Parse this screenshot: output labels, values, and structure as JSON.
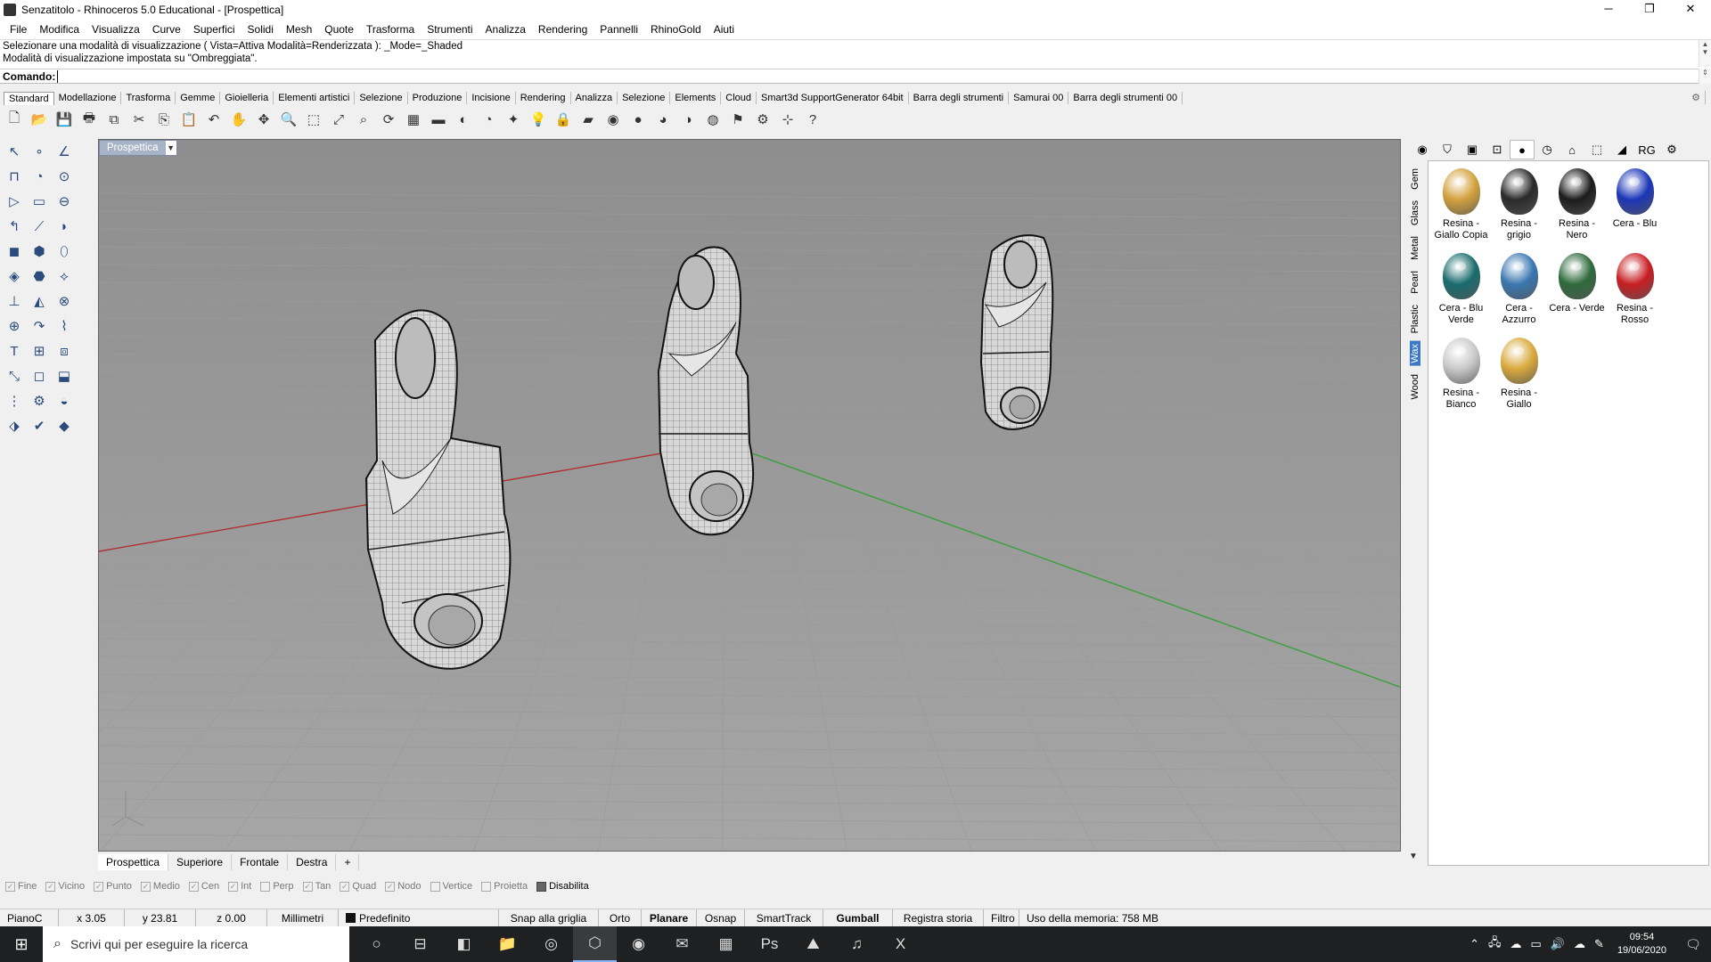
{
  "window": {
    "title": "Senzatitolo - Rhinoceros 5.0 Educational - [Prospettica]",
    "controls": [
      "─",
      "❐",
      "✕"
    ]
  },
  "menu": [
    "File",
    "Modifica",
    "Visualizza",
    "Curve",
    "Superfici",
    "Solidi",
    "Mesh",
    "Quote",
    "Trasforma",
    "Strumenti",
    "Analizza",
    "Rendering",
    "Pannelli",
    "RhinoGold",
    "Aiuti"
  ],
  "command": {
    "history": [
      "Selezionare una modalità di visualizzazione ( Vista=Attiva  Modalità=Renderizzata ): _Mode=_Shaded",
      "Modalità di visualizzazione impostata su \"Ombreggiata\"."
    ],
    "prompt": "Comando:"
  },
  "toolbar_tabs": [
    "Standard",
    "Modellazione",
    "Trasforma",
    "Gemme",
    "Gioielleria",
    "Elementi artistici",
    "Selezione",
    "Produzione",
    "Incisione",
    "Rendering",
    "Analizza",
    "Selezione",
    "Elements",
    "Cloud",
    "Smart3d SupportGenerator 64bit",
    "Barra degli strumenti",
    "Samurai 00",
    "Barra degli strumenti 00"
  ],
  "toolbar_icons": [
    "new-icon",
    "open-icon",
    "save-icon",
    "print-icon",
    "copy-page-icon",
    "cut-icon",
    "copy-icon",
    "paste-icon",
    "undo-icon",
    "pan-icon",
    "move-icon",
    "zoom-icon",
    "zoom-window-icon",
    "zoom-extents-icon",
    "zoom-selected-icon",
    "rotate-view-icon",
    "grid-icon",
    "car-icon",
    "render-preview-icon",
    "camera-icon",
    "grab-icon",
    "light-icon",
    "lock-icon",
    "layer-icon",
    "color-wheel-icon",
    "sphere-icon",
    "shaded-sphere-icon",
    "rendered-sphere-icon",
    "blue-sphere-icon",
    "flag-icon",
    "gear-icon",
    "snap-icon",
    "help-icon"
  ],
  "toolbar_glyphs": [
    "🗋",
    "📂",
    "💾",
    "🖶",
    "⧉",
    "✂",
    "⎘",
    "📋",
    "↶",
    "✋",
    "✥",
    "🔍",
    "⬚",
    "⤢",
    "⌕",
    "⟳",
    "▦",
    "▬",
    "◐",
    "◔",
    "✦",
    "💡",
    "🔒",
    "▰",
    "◉",
    "●",
    "◕",
    "◑",
    "◍",
    "⚑",
    "⚙",
    "⊹",
    "?"
  ],
  "left_tools": [
    "↖",
    "∘",
    "∠",
    "⊓",
    "◔",
    "⊙",
    "▷",
    "▭",
    "⊖",
    "↰",
    "⟋",
    "◗",
    "◼",
    "⬢",
    "⬯",
    "◈",
    "⬣",
    "⟡",
    "⊥",
    "◭",
    "⊗",
    "⊕",
    "↷",
    "⌇",
    "T",
    "⊞",
    "⧈",
    "⤡",
    "◻",
    "⬓",
    "⋮",
    "⚙",
    "◒",
    "⬗",
    "✔",
    "◆"
  ],
  "viewport": {
    "label": "Prospettica"
  },
  "viewport_tabs": [
    "Prospettica",
    "Superiore",
    "Frontale",
    "Destra",
    "+"
  ],
  "panel": {
    "top_icons": [
      "◉",
      "⛉",
      "▣",
      "⊡",
      "●",
      "◷",
      "⌂",
      "⬚",
      "◢",
      "RG",
      "⚙"
    ],
    "categories": [
      "Gem",
      "Glass",
      "Metal",
      "Pearl",
      "Plastic",
      "Wax",
      "Wood"
    ],
    "selected_category": "Wax",
    "materials": [
      {
        "label": "Resina - Giallo Copia",
        "color": "#d3a23e"
      },
      {
        "label": "Resina - grigio",
        "color": "#2a2a2a"
      },
      {
        "label": "Resina - Nero",
        "color": "#1c1c1c"
      },
      {
        "label": "Cera - Blu",
        "color": "#1c36b8"
      },
      {
        "label": "Cera - Blu Verde",
        "color": "#1a6b6e"
      },
      {
        "label": "Cera - Azzurro",
        "color": "#3a77b0"
      },
      {
        "label": "Cera - Verde",
        "color": "#2f6a3c"
      },
      {
        "label": "Resina - Rosso",
        "color": "#c81e22"
      },
      {
        "label": "Resina - Bianco",
        "color": "#c9c9c9"
      },
      {
        "label": "Resina - Giallo",
        "color": "#d9a93c"
      }
    ]
  },
  "osnaps": [
    "Fine",
    "Vicino",
    "Punto",
    "Medio",
    "Cen",
    "Int",
    "Perp",
    "Tan",
    "Quad",
    "Nodo",
    "Vertice",
    "Proietta",
    "Disabilita"
  ],
  "osnap_checked": [
    true,
    true,
    true,
    true,
    true,
    true,
    false,
    true,
    true,
    true,
    false,
    false,
    true
  ],
  "status": {
    "cplane": "PianoC",
    "x": "x 3.05",
    "y": "y 23.81",
    "z": "z 0.00",
    "units": "Millimetri",
    "layer": "Predefinito",
    "toggles": [
      "Snap alla griglia",
      "Orto",
      "Planare",
      "Osnap",
      "SmartTrack",
      "Gumball",
      "Registra storia",
      "Filtro"
    ],
    "toggles_bold": [
      false,
      false,
      true,
      false,
      false,
      true,
      false,
      false
    ],
    "memory": "Uso della memoria: 758 MB"
  },
  "taskbar": {
    "search_placeholder": "Scrivi qui per eseguire la ricerca",
    "apps": [
      "○",
      "⊟",
      "◧",
      "📁",
      "◎",
      "⬡",
      "◉",
      "✉",
      "▦",
      "Ps",
      "⛰",
      "♫",
      "X"
    ],
    "time": "09:54",
    "date": "19/06/2020"
  },
  "colors": {
    "x_axis": "#b03030",
    "y_axis": "#3aa03a",
    "accent": "#3c78c8"
  }
}
